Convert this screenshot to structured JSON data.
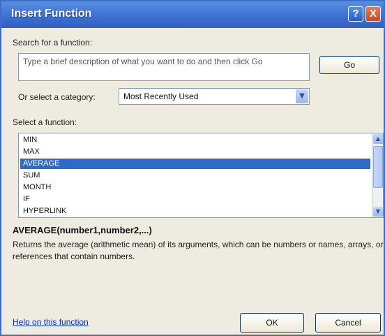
{
  "window": {
    "title": "Insert Function"
  },
  "titlebar": {
    "help_label": "?",
    "close_label": "X"
  },
  "search": {
    "label": "Search for a function:",
    "text": "Type a brief description of what you want to do and then click Go",
    "go_label": "Go"
  },
  "category": {
    "label": "Or select a category:",
    "selected": "Most Recently Used"
  },
  "functions": {
    "label": "Select a function:",
    "items": [
      "MIN",
      "MAX",
      "AVERAGE",
      "SUM",
      "MONTH",
      "IF",
      "HYPERLINK"
    ],
    "selected": "AVERAGE"
  },
  "details": {
    "signature": "AVERAGE(number1,number2,...)",
    "description": "Returns the average (arithmetic mean) of its arguments, which can be numbers or names, arrays, or references that contain numbers."
  },
  "footer": {
    "help_link": "Help on this function",
    "ok_label": "OK",
    "cancel_label": "Cancel"
  },
  "icons": {
    "dropdown": "chevron-down-icon",
    "scroll_up": "arrow-up-icon",
    "scroll_down": "arrow-down-icon"
  },
  "colors": {
    "titlebar": "#3c6fd0",
    "selection": "#316ac5",
    "window_bg": "#eeebe0"
  }
}
